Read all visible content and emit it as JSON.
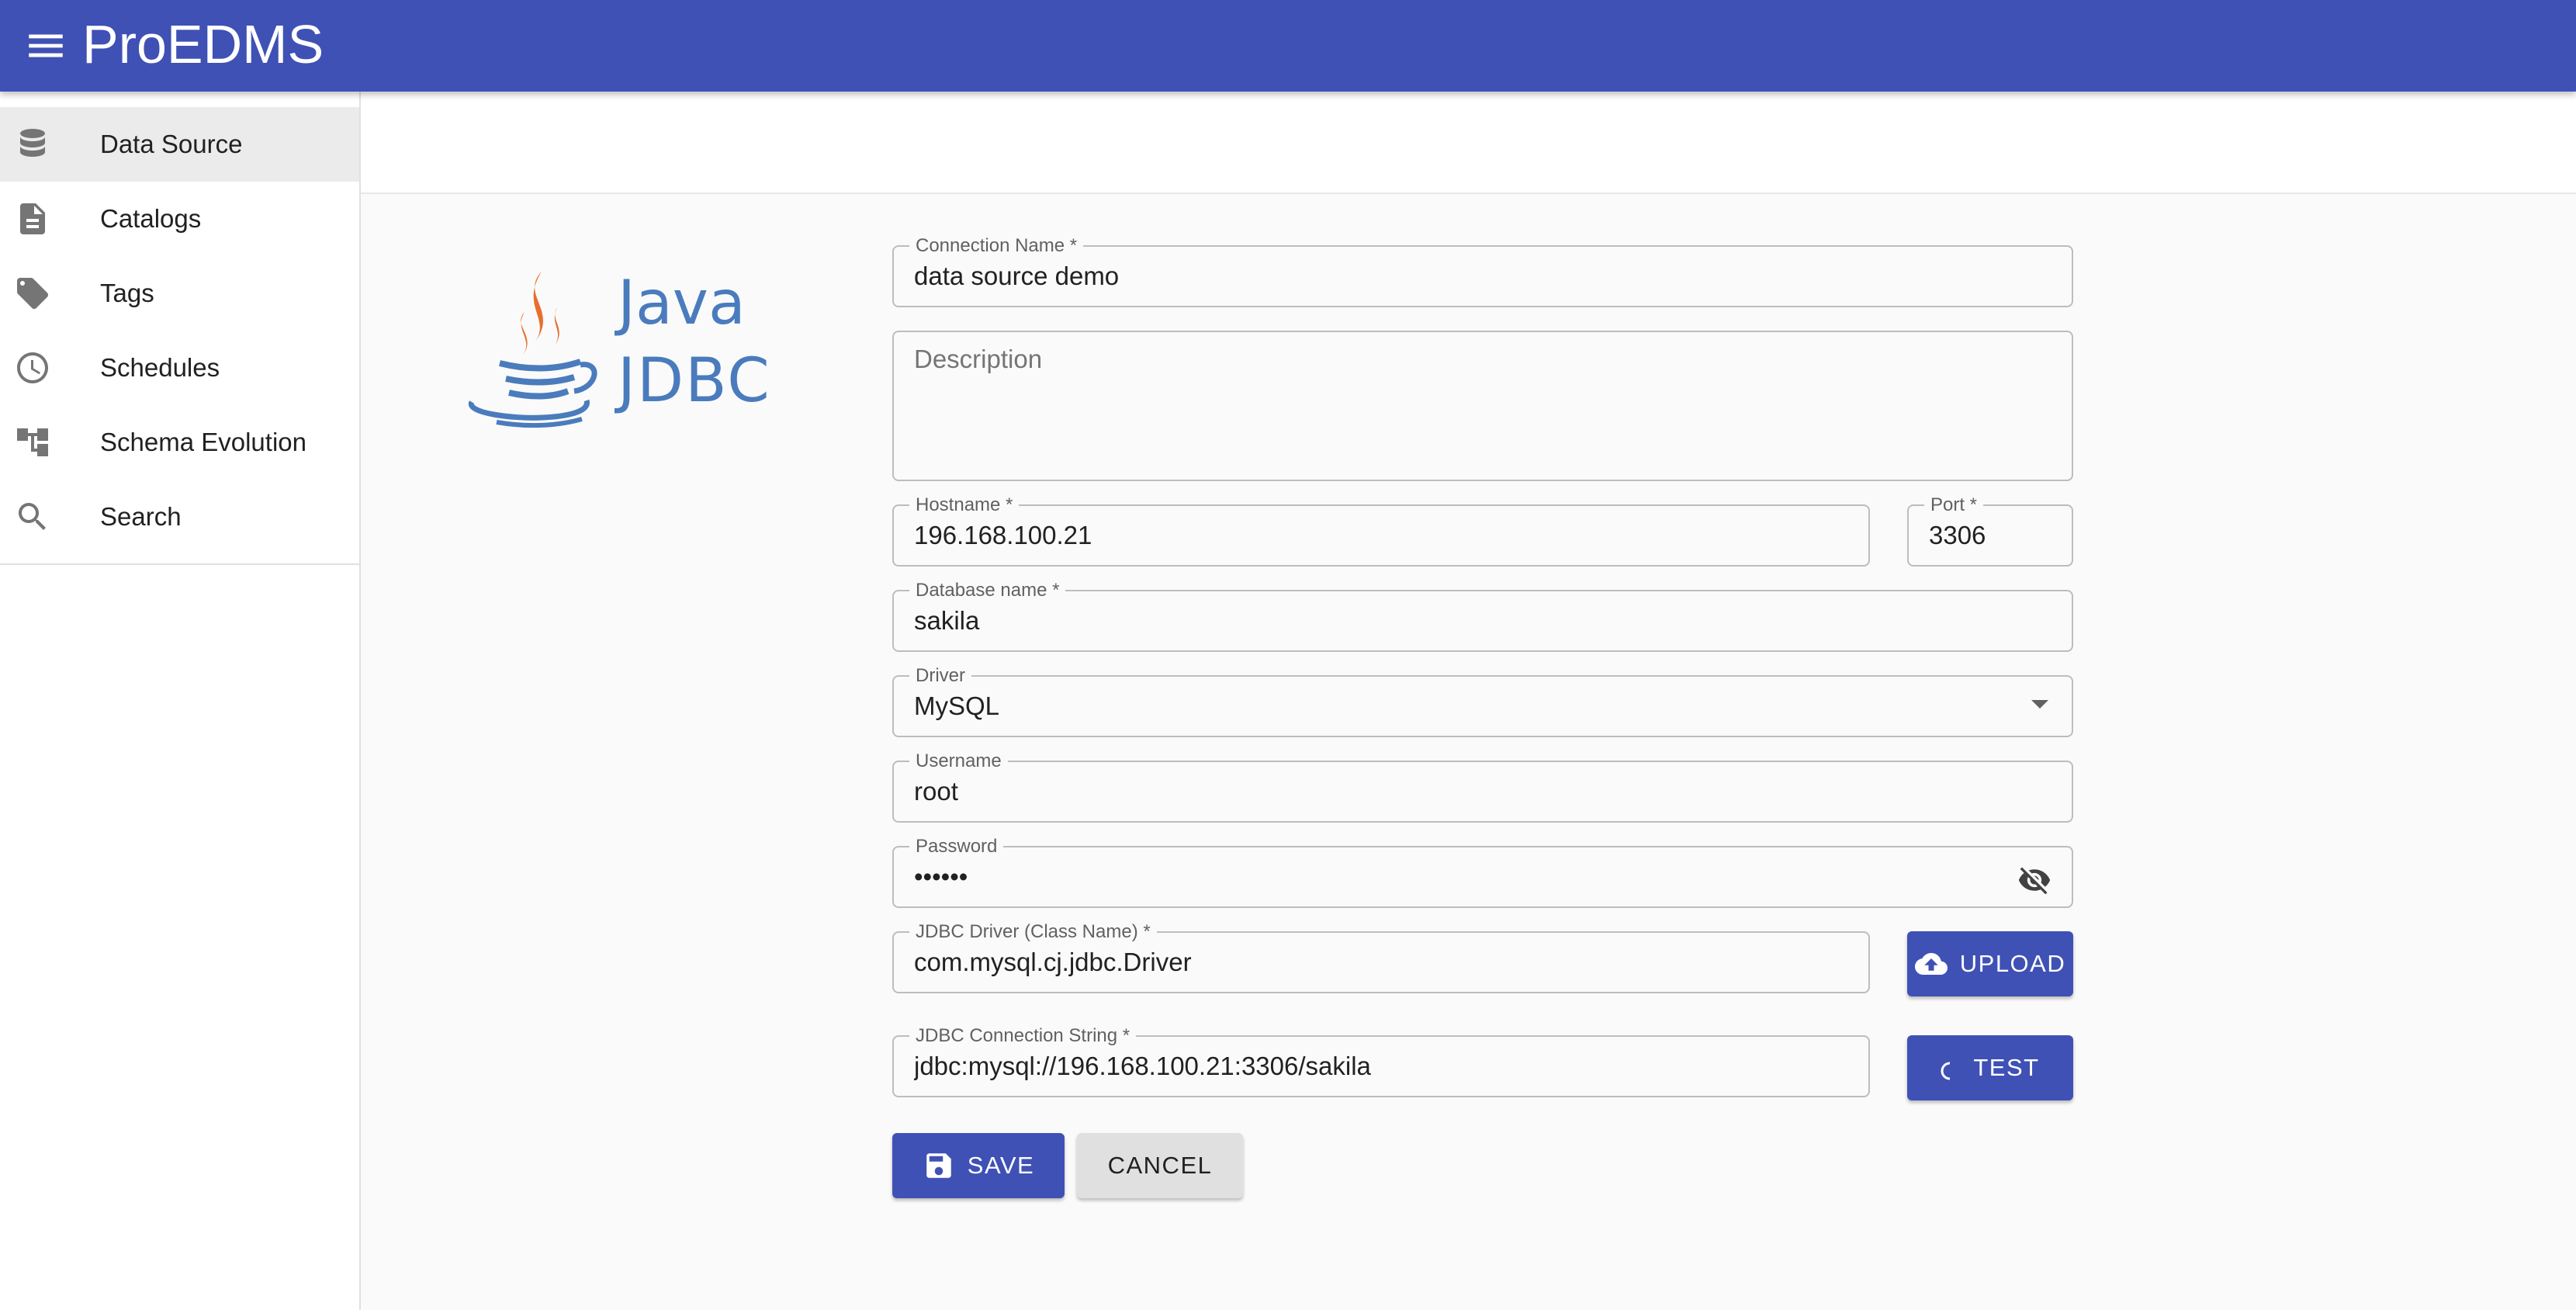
{
  "app": {
    "title": "ProEDMS"
  },
  "sidebar": {
    "items": [
      {
        "label": "Data Source",
        "icon": "database-icon",
        "active": true
      },
      {
        "label": "Catalogs",
        "icon": "document-icon"
      },
      {
        "label": "Tags",
        "icon": "tag-icon"
      },
      {
        "label": "Schedules",
        "icon": "clock-icon"
      },
      {
        "label": "Schema Evolution",
        "icon": "schema-tree-icon"
      },
      {
        "label": "Search",
        "icon": "search-icon"
      }
    ]
  },
  "logo": {
    "line1": "Java",
    "line2": "JDBC"
  },
  "form": {
    "connection_name": {
      "label": "Connection Name *",
      "value": "data source demo"
    },
    "description": {
      "placeholder": "Description"
    },
    "hostname": {
      "label": "Hostname *",
      "value": "196.168.100.21"
    },
    "port": {
      "label": "Port *",
      "value": "3306"
    },
    "database_name": {
      "label": "Database name *",
      "value": "sakila"
    },
    "driver": {
      "label": "Driver",
      "value": "MySQL"
    },
    "username": {
      "label": "Username",
      "value": "root"
    },
    "password": {
      "label": "Password",
      "value": "••••••"
    },
    "jdbc_driver": {
      "label": "JDBC Driver (Class Name) *",
      "value": "com.mysql.cj.jdbc.Driver"
    },
    "jdbc_connection": {
      "label": "JDBC Connection String *",
      "value": "jdbc:mysql://196.168.100.21:3306/sakila"
    }
  },
  "buttons": {
    "upload": "UPLOAD",
    "test": "TEST",
    "save": "SAVE",
    "cancel": "CANCEL"
  },
  "colors": {
    "primary": "#3f51b5",
    "java_blue": "#4a7bbd",
    "java_orange": "#e76f2e"
  }
}
